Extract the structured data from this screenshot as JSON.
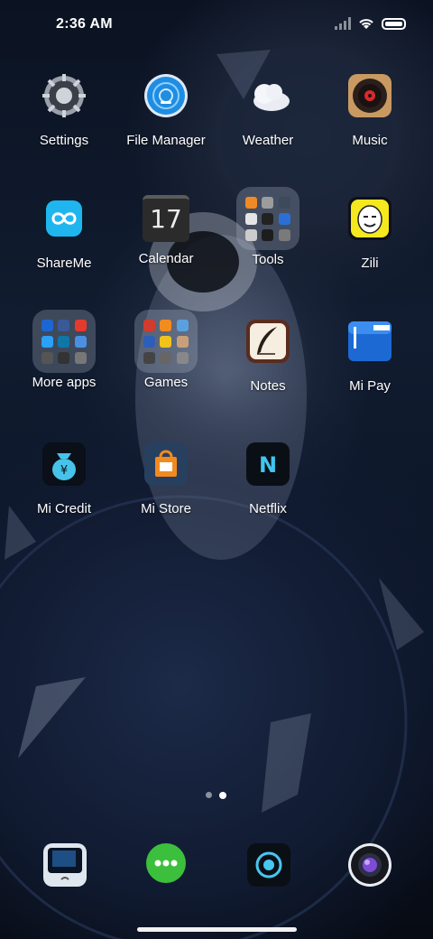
{
  "status_bar": {
    "time": "2:36 AM",
    "icons": [
      "signal-icon",
      "wifi-icon",
      "battery-icon"
    ]
  },
  "apps": [
    {
      "label": "Settings",
      "icon": "settings-gear-icon"
    },
    {
      "label": "File Manager",
      "icon": "file-manager-icon"
    },
    {
      "label": "Weather",
      "icon": "weather-cloud-icon"
    },
    {
      "label": "Music",
      "icon": "music-record-icon"
    },
    {
      "label": "ShareMe",
      "icon": "shareme-infinity-icon"
    },
    {
      "label": "Calendar",
      "icon": "calendar-icon",
      "date": "17"
    },
    {
      "label": "Tools",
      "icon": "folder-icon"
    },
    {
      "label": "Zili",
      "icon": "zili-face-icon"
    },
    {
      "label": "More apps",
      "icon": "folder-icon"
    },
    {
      "label": "Games",
      "icon": "folder-icon"
    },
    {
      "label": "Notes",
      "icon": "notes-quill-icon"
    },
    {
      "label": "Mi Pay",
      "icon": "mi-pay-wallet-icon"
    },
    {
      "label": "Mi Credit",
      "icon": "mi-credit-bag-icon"
    },
    {
      "label": "Mi Store",
      "icon": "mi-store-bag-icon"
    },
    {
      "label": "Netflix",
      "icon": "netflix-n-icon"
    }
  ],
  "dock": [
    {
      "name": "phone",
      "icon": "phone-icon"
    },
    {
      "name": "messaging",
      "icon": "message-bubble-icon"
    },
    {
      "name": "browser",
      "icon": "browser-icon"
    },
    {
      "name": "camera",
      "icon": "camera-lens-icon"
    }
  ],
  "pages": {
    "count": 2,
    "current": 2
  }
}
